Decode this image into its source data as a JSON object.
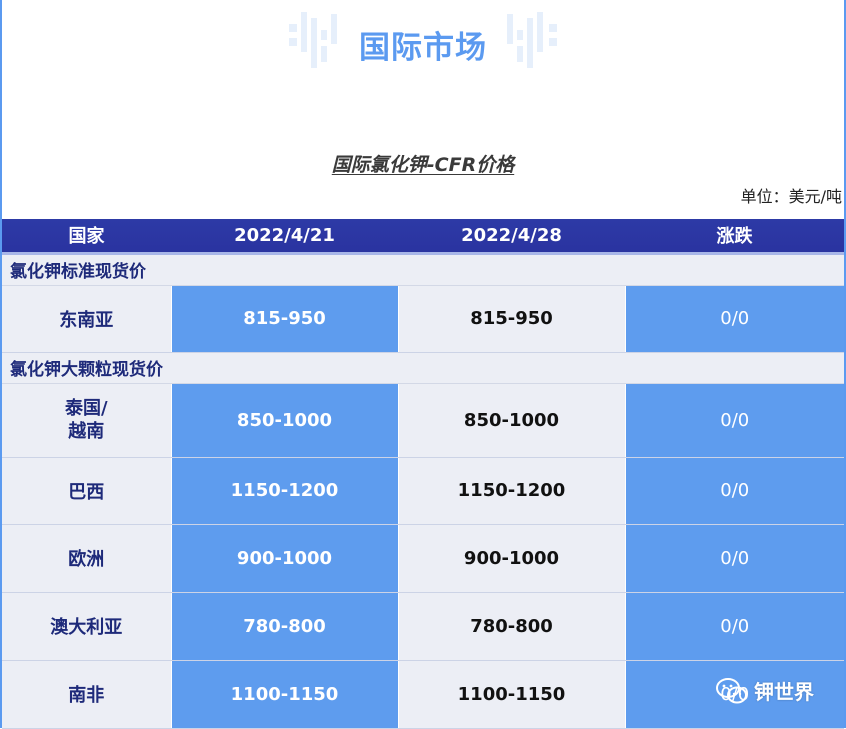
{
  "banner": {
    "title": "国际市场"
  },
  "subtitle": "国际氯化钾-CFR价格",
  "unit": "单位：美元/吨",
  "table": {
    "headers": [
      "国家",
      "2022/4/21",
      "2022/4/28",
      "涨跌"
    ],
    "sections": [
      {
        "label": "氯化钾标准现货价",
        "rows": [
          {
            "country": "东南亚",
            "p1": "815-950",
            "p2": "815-950",
            "change": "0/0"
          }
        ]
      },
      {
        "label": "氯化钾大颗粒现货价",
        "rows": [
          {
            "country": "泰国/\n越南",
            "p1": "850-1000",
            "p2": "850-1000",
            "change": "0/0"
          },
          {
            "country": "巴西",
            "p1": "1150-1200",
            "p2": "1150-1200",
            "change": "0/0"
          },
          {
            "country": "欧洲",
            "p1": "900-1000",
            "p2": "900-1000",
            "change": "0/0"
          },
          {
            "country": "澳大利亚",
            "p1": "780-800",
            "p2": "780-800",
            "change": "0/0"
          },
          {
            "country": "南非",
            "p1": "1100-1150",
            "p2": "1100-1150",
            "change": "0/0"
          }
        ]
      }
    ]
  },
  "watermark": {
    "icon": "wechat-icon",
    "text": "钾世界"
  }
}
